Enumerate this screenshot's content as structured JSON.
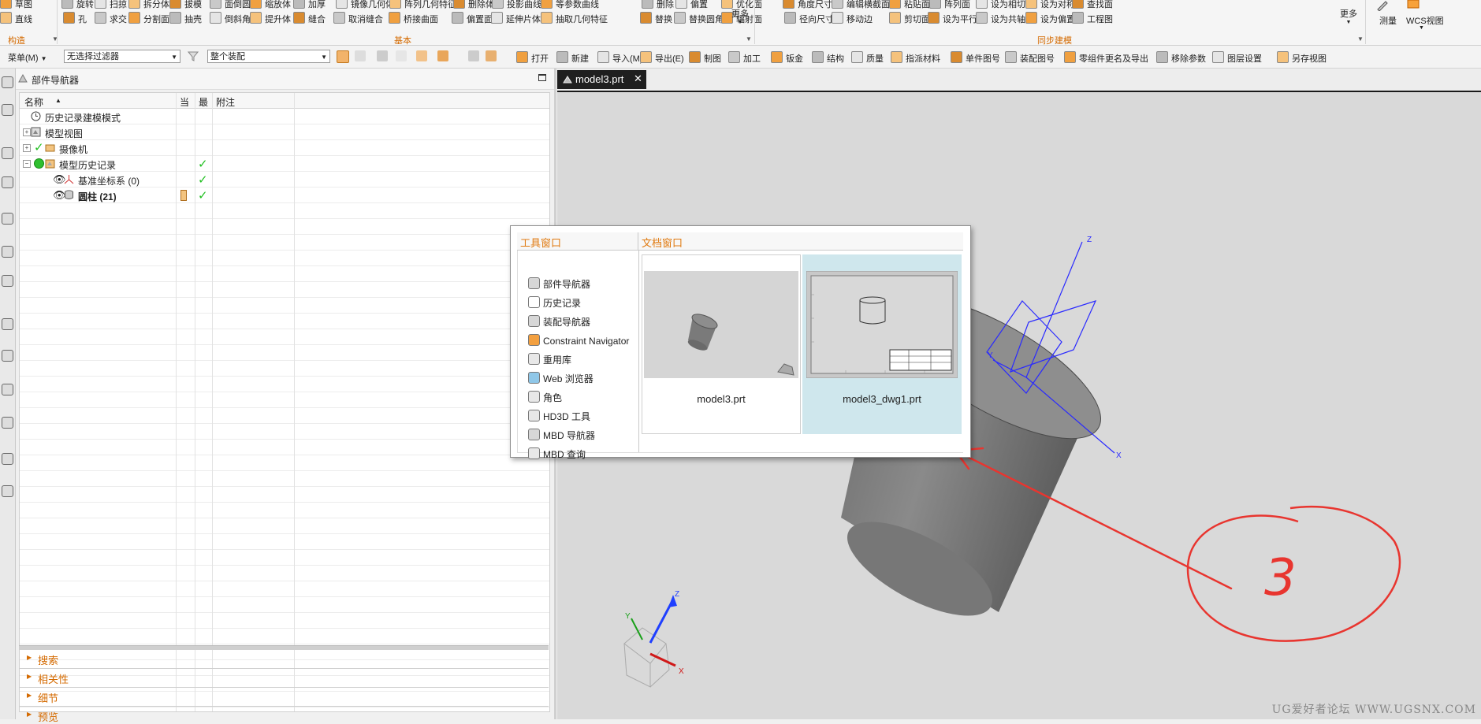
{
  "ribbon": {
    "group_construct": "构造",
    "group_basic": "基本",
    "group_sync": "同步建模",
    "more1": "更多",
    "more2": "更多",
    "measure": "测量",
    "wcs_view": "WCS视图",
    "row1": [
      "草图",
      "旋转",
      "扫掠",
      "拆分体",
      "拔模",
      "面倒圆",
      "缩放体",
      "加厚",
      "镜像几何体",
      "阵列几何特征",
      "删除体",
      "投影曲线",
      "等参数曲线",
      "删除",
      "偏置",
      "优化面",
      "角度尺寸",
      "编辑横截面",
      "粘贴面",
      "阵列面",
      "设为相切",
      "设为对称",
      "查找面"
    ],
    "row2": [
      "直线",
      "孔",
      "求交",
      "分割面",
      "抽壳",
      "倒斜角",
      "提升体",
      "缝合",
      "取消缝合",
      "桥接曲面",
      "偏置面",
      "延伸片体",
      "抽取几何特征",
      "替换",
      "替换圆角",
      "辐射面",
      "径向尺寸",
      "移动边",
      "剪切面",
      "设为平行",
      "设为共轴",
      "设为偏置",
      "工程图"
    ]
  },
  "toolbar": {
    "menu": "菜单(M)",
    "filter": "无选择过滤器",
    "scope": "整个装配",
    "items": [
      "打开",
      "新建",
      "导入(M)",
      "导出(E)",
      "制图",
      "加工",
      "钣金",
      "结构",
      "质量",
      "指派材料",
      "单件图号",
      "装配图号",
      "零组件更名及导出",
      "移除参数",
      "图层设置",
      "另存视图"
    ]
  },
  "navigator": {
    "title": "部件导航器",
    "columns": {
      "name": "名称",
      "current": "当",
      "latest": "最",
      "notes": "附注"
    },
    "rows": [
      {
        "label": "历史记录建模模式"
      },
      {
        "label": "模型视图"
      },
      {
        "label": "摄像机"
      },
      {
        "label": "模型历史记录"
      },
      {
        "label": "基准坐标系 (0)"
      },
      {
        "label": "圆柱 (21)"
      }
    ],
    "sections": [
      "搜索",
      "相关性",
      "细节",
      "预览"
    ]
  },
  "viewport": {
    "tab_label": "model3.prt",
    "tab_close": "✕",
    "annotation_label": "3",
    "axis_labels": {
      "x": "X",
      "y": "Y",
      "z": "Z"
    }
  },
  "switcher": {
    "tool_header": "工具窗口",
    "doc_header": "文档窗口",
    "tools": [
      "部件导航器",
      "历史记录",
      "装配导航器",
      "Constraint Navigator",
      "重用库",
      "Web 浏览器",
      "角色",
      "HD3D 工具",
      "MBD 导航器",
      "MBD 查询"
    ],
    "docs": [
      {
        "label": "model3.prt"
      },
      {
        "label": "model3_dwg1.prt"
      }
    ]
  },
  "watermark": "UG爱好者论坛 WWW.UGSNX.COM",
  "colors": {
    "accent_orange": "#d46a00",
    "selected_card": "#cfe7ed",
    "check_green": "#22c022",
    "annotation_red": "#e8352f"
  }
}
